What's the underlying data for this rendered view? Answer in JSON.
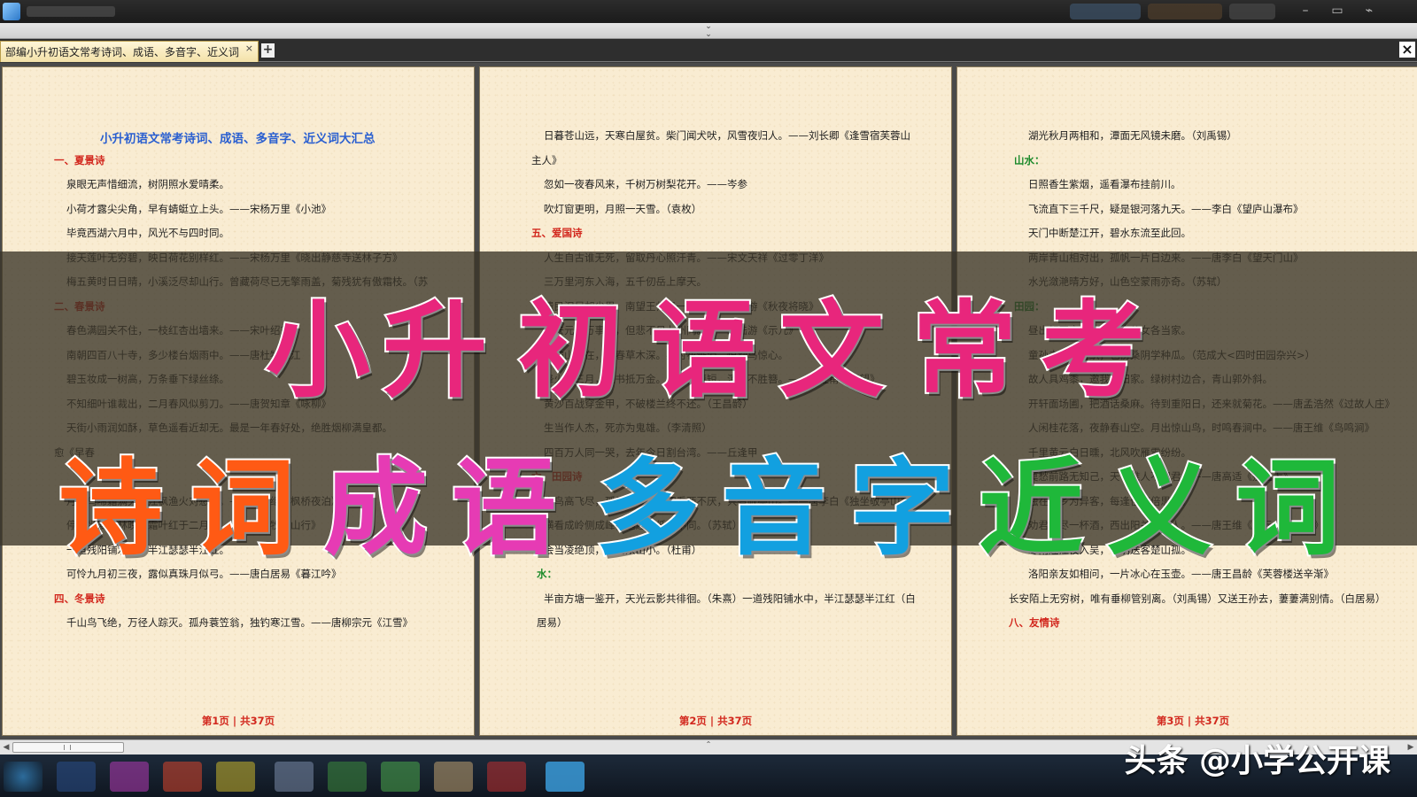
{
  "tabbar": {
    "tab_label": "部编小升初语文常考诗词、成语、多音字、近义词",
    "tab_close": "×",
    "add_tab": "+",
    "close_all": "×"
  },
  "pages": [
    {
      "lines": [
        {
          "text": "小升初语文常考诗词、成语、多音字、近义词大汇总",
          "style": "title"
        },
        {
          "text": "一、夏景诗",
          "style": "red"
        },
        {
          "text": "泉眼无声惜细流，树阴照水爱晴柔。",
          "style": "body"
        },
        {
          "text": "小荷才露尖尖角，早有蜻蜓立上头。——宋杨万里《小池》",
          "style": "body"
        },
        {
          "text": "毕竟西湖六月中，风光不与四时同。",
          "style": "body"
        },
        {
          "text": "接天莲叶无穷碧，映日荷花别样红。——宋杨万里《晓出静慈寺送林子方》",
          "style": "body"
        },
        {
          "text": "梅五黄时日日晴，小溪泛尽却山行。曾藏荷尽已无擎雨盖，菊残犹有傲霜枝。（苏",
          "style": "body"
        },
        {
          "text": "二、春景诗",
          "style": "red"
        },
        {
          "text": "春色满园关不住，一枝红杏出墙来。——宋叶绍翁",
          "style": "body"
        },
        {
          "text": "南朝四百八十寺，多少楼台烟雨中。——唐杜牧《江",
          "style": "body"
        },
        {
          "text": "碧玉妆成一树高，万条垂下绿丝绦。",
          "style": "body"
        },
        {
          "text": "不知细叶谁裁出，二月春风似剪刀。——唐贺知章《咏柳》",
          "style": "body"
        },
        {
          "text": "天街小雨润如酥，草色遥看近却无。最是一年春好处，绝胜烟柳满皇都。",
          "style": "body"
        },
        {
          "text": "愈《早春",
          "style": "body-flush"
        },
        {
          "text": "",
          "style": "body"
        },
        {
          "text": "月落乌啼霜满天，江枫渔火对愁眠。——唐张继《枫桥夜泊》",
          "style": "body"
        },
        {
          "text": "停车坐爱枫林晚，霜叶红于二月花。——唐杜牧《山行》",
          "style": "body"
        },
        {
          "text": "一道残阳铺水中，半江瑟瑟半江红。",
          "style": "body"
        },
        {
          "text": "可怜九月初三夜，露似真珠月似弓。——唐白居易《暮江吟》",
          "style": "body"
        },
        {
          "text": "四、冬景诗",
          "style": "red"
        },
        {
          "text": "千山鸟飞绝，万径人踪灭。孤舟蓑笠翁，独钓寒江雪。——唐柳宗元《江雪》",
          "style": "body"
        }
      ],
      "page_num": "第1页 | 共37页"
    },
    {
      "lines": [
        {
          "text": "日暮苍山远，天寒白屋贫。柴门闻犬吠，风雪夜归人。——刘长卿《逢雪宿芙蓉山",
          "style": "body"
        },
        {
          "text": "主人》",
          "style": "body-flush"
        },
        {
          "text": "忽如一夜春风来，千树万树梨花开。——岑参",
          "style": "body"
        },
        {
          "text": "吹灯窗更明，月照一天雪。（袁枚）",
          "style": "body"
        },
        {
          "text": "五、爱国诗",
          "style": "red"
        },
        {
          "text": "人生自古谁无死，留取丹心照汗青。——宋文天祥《过零丁洋》",
          "style": "body"
        },
        {
          "text": "三万里河东入海，五千仞岳上摩天。",
          "style": "body"
        },
        {
          "text": "遗民泪尽胡尘里，南望王师又一年。——宋陆游《秋夜将晓》",
          "style": "body"
        },
        {
          "text": "死去元知万事空，但悲不见九州同。——宋陆游《示儿》",
          "style": "body"
        },
        {
          "text": "国破山河在，城春草木深。感时花溅泪，恨别鸟惊心。",
          "style": "body"
        },
        {
          "text": "烽火连三月，家书抵万金。白头搔更短，浑欲不胜簪。——唐杜甫《春望》",
          "style": "body"
        },
        {
          "text": "黄沙百战穿金甲，不破楼兰终不还。（王昌龄）",
          "style": "body"
        },
        {
          "text": "生当作人杰，死亦为鬼雄。（李清照）",
          "style": "body"
        },
        {
          "text": "四百万人同一哭，去年今日割台湾。——丘逢甲",
          "style": "body"
        },
        {
          "text": "六、田园诗",
          "style": "red"
        },
        {
          "text": "众鸟高飞尽，孤云独去闲。相看两不厌，只有敬亭山。——唐李白《独坐敬亭山》",
          "style": "body"
        },
        {
          "text": "横看成岭侧成峰，远近高低各不同。（苏轼）",
          "style": "body"
        },
        {
          "text": "会当凌绝顶，一览众山小。（杜甫）",
          "style": "body"
        },
        {
          "text": "水：",
          "style": "green"
        },
        {
          "text": "半亩方塘一鉴开，天光云影共徘徊。（朱熹）一道残阳铺水中，半江瑟瑟半江红（白",
          "style": "body"
        },
        {
          "text": "居易）",
          "style": "body-flush2"
        }
      ],
      "page_num": "第2页 | 共37页"
    },
    {
      "lines": [
        {
          "text": "湖光秋月两相和，潭面无风镜未磨。（刘禹锡）",
          "style": "body"
        },
        {
          "text": "山水：",
          "style": "green"
        },
        {
          "text": "日照香生紫烟，遥看瀑布挂前川。",
          "style": "body"
        },
        {
          "text": "飞流直下三千尺，疑是银河落九天。——李白《望庐山瀑布》",
          "style": "body"
        },
        {
          "text": "天门中断楚江开，碧水东流至此回。",
          "style": "body"
        },
        {
          "text": "两岸青山相对出，孤帆一片日边来。——唐李白《望天门山》",
          "style": "body"
        },
        {
          "text": "水光潋滟晴方好，山色空蒙雨亦奇。（苏轼）",
          "style": "body"
        },
        {
          "text": "田园：",
          "style": "green"
        },
        {
          "text": "昼出耘田夜绩麻，村庄儿女各当家。",
          "style": "body"
        },
        {
          "text": "童孙未解供耕织，也傍桑阴学种瓜。（范成大<四时田园杂兴>）",
          "style": "body"
        },
        {
          "text": "故人具鸡黍，邀我至田家。绿树村边合，青山郭外斜。",
          "style": "body"
        },
        {
          "text": "开轩面场圃，把酒话桑麻。待到重阳日，还来就菊花。——唐孟浩然《过故人庄》",
          "style": "body"
        },
        {
          "text": "人闲桂花落，夜静春山空。月出惊山鸟，时鸣春涧中。——唐王维《鸟鸣涧》",
          "style": "body"
        },
        {
          "text": "千里黄云白日曛，北风吹雁雪纷纷。",
          "style": "body"
        },
        {
          "text": "莫愁前路无知己，天下谁人不识君。——唐高适《别董大》",
          "style": "body"
        },
        {
          "text": "独在异乡为异客，每逢佳节倍思亲。",
          "style": "body"
        },
        {
          "text": "劝君更尽一杯酒，西出阳关无故人。——唐王维《送元二使安西》",
          "style": "body"
        },
        {
          "text": "寒雨连江夜入吴，平明送客楚山孤。",
          "style": "body"
        },
        {
          "text": "洛阳亲友如相问，一片冰心在玉壶。——唐王昌龄《芙蓉楼送辛渐》",
          "style": "body"
        },
        {
          "text": "长安陌上无穷树，唯有垂柳管别离。（刘禹锡）又送王孙去，萋萋满别情。（白居易）",
          "style": "body-flush"
        },
        {
          "text": "八、友情诗",
          "style": "red"
        }
      ],
      "page_num": "第3页 | 共37页"
    }
  ],
  "overlay": {
    "row1": [
      "小",
      "升",
      "初",
      "语",
      "文",
      "常",
      "考"
    ],
    "row2": [
      {
        "char": "诗",
        "color": "#ff5a14"
      },
      {
        "char": "词",
        "color": "#ff5a14"
      },
      {
        "char": "成",
        "color": "#e63bb4"
      },
      {
        "char": "语",
        "color": "#e63bb4"
      },
      {
        "char": "多",
        "color": "#12a0e0"
      },
      {
        "char": "音",
        "color": "#12a0e0"
      },
      {
        "char": "字",
        "color": "#12a0e0"
      },
      {
        "char": "近",
        "color": "#1fb83a"
      },
      {
        "char": "义",
        "color": "#1fb83a"
      },
      {
        "char": "词",
        "color": "#1fb83a"
      }
    ],
    "row1_color": "#e8267c"
  },
  "watermark": "头条 @小学公开课"
}
